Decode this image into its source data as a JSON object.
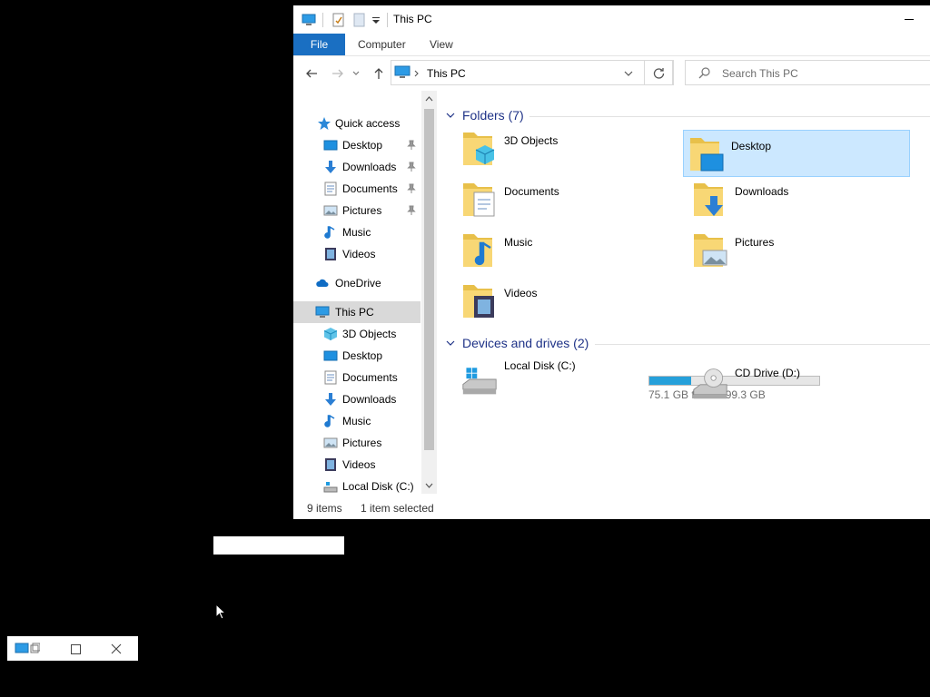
{
  "window": {
    "title": "This PC",
    "ribbon_tabs": [
      "File",
      "Computer",
      "View"
    ],
    "address": "This PC",
    "search_placeholder": "Search This PC"
  },
  "nav_pane": {
    "quick_access": "Quick access",
    "quick_items": [
      "Desktop",
      "Downloads",
      "Documents",
      "Pictures",
      "Music",
      "Videos"
    ],
    "onedrive": "OneDrive",
    "this_pc": "This PC",
    "pc_items": [
      "3D Objects",
      "Desktop",
      "Documents",
      "Downloads",
      "Music",
      "Pictures",
      "Videos",
      "Local Disk (C:)"
    ]
  },
  "content": {
    "folders_header": "Folders (7)",
    "folders": [
      "3D Objects",
      "Desktop",
      "Documents",
      "Downloads",
      "Music",
      "Pictures",
      "Videos"
    ],
    "selected_folder": "Desktop",
    "drives_header": "Devices and drives (2)",
    "drives": [
      {
        "name": "Local Disk (C:)",
        "free": "75.1 GB free of 99.3 GB",
        "used_fraction": 0.244
      },
      {
        "name": "CD Drive (D:)"
      }
    ]
  },
  "status": {
    "items": "9 items",
    "selected": "1 item selected"
  },
  "colors": {
    "accent": "#1a6fc2",
    "selection": "#cce8ff",
    "drive_bar": "#26a0da",
    "group_header": "#1e3287"
  }
}
